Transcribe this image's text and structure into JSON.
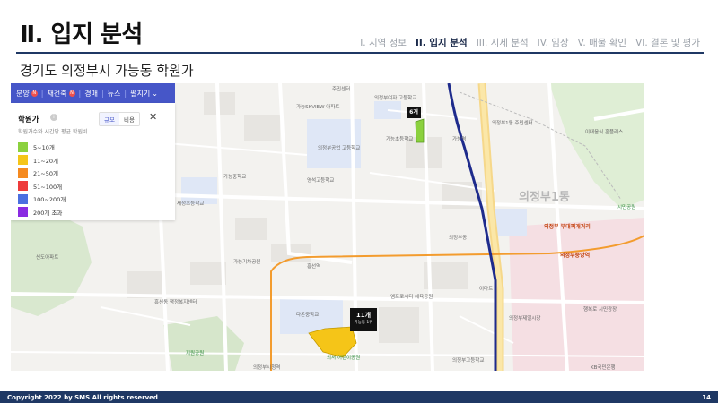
{
  "header": {
    "title": "Ⅱ. 입지 분석",
    "subtitle": "경기도 의정부시 가능동 학원가",
    "nav": [
      {
        "label": "I. 지역 정보",
        "active": false
      },
      {
        "label": "II. 입지 분석",
        "active": true
      },
      {
        "label": "III. 시세 분석",
        "active": false
      },
      {
        "label": "IV. 임장",
        "active": false
      },
      {
        "label": "V. 매물 확인",
        "active": false
      },
      {
        "label": "VI. 결론 및 평가",
        "active": false
      }
    ]
  },
  "map": {
    "toolbar": {
      "items": [
        {
          "label": "분양",
          "badge": "N"
        },
        {
          "label": "재건축",
          "badge": "N"
        },
        {
          "label": "경매",
          "badge": ""
        },
        {
          "label": "뉴스",
          "badge": ""
        },
        {
          "label": "펼치기",
          "badge": ""
        }
      ]
    },
    "legend": {
      "title": "학원가",
      "info_icon": "i",
      "description": "학원가수와 시간당 평균 학원비",
      "toggle": [
        "규모",
        "비용"
      ],
      "close": "✕",
      "items": [
        {
          "label": "5~10개",
          "color": "#8bd13e"
        },
        {
          "label": "11~20개",
          "color": "#f5c518"
        },
        {
          "label": "21~50개",
          "color": "#f58a1f"
        },
        {
          "label": "51~100개",
          "color": "#ee3b3b"
        },
        {
          "label": "100~200개",
          "color": "#4b6fe0"
        },
        {
          "label": "200개 초과",
          "color": "#8a2be2"
        }
      ]
    },
    "markers": [
      {
        "count": "6개",
        "sub": ""
      },
      {
        "count": "11개",
        "sub": "가능동 1위"
      }
    ],
    "labels": [
      {
        "text": "주민센터"
      },
      {
        "text": "가능SKVIEW 아파트"
      },
      {
        "text": "의정부여자 고등학교"
      },
      {
        "text": "가능초등학교"
      },
      {
        "text": "가능역"
      },
      {
        "text": "의정부공업 고등학교"
      },
      {
        "text": "영석고등학교"
      },
      {
        "text": "가능중학교"
      },
      {
        "text": "의정부동"
      },
      {
        "text": "의정부1동"
      },
      {
        "text": "의정부 부대찌개거리"
      },
      {
        "text": "의정부중앙역"
      },
      {
        "text": "흥선역"
      },
      {
        "text": "의정부시청역"
      },
      {
        "text": "엠프로시티 체육공원"
      },
      {
        "text": "의정부고등학교"
      },
      {
        "text": "흥선동 행정복지센터"
      },
      {
        "text": "신도아파트"
      },
      {
        "text": "재정초등학교"
      },
      {
        "text": "지원공원"
      },
      {
        "text": "가능기차공원"
      },
      {
        "text": "행복로 시민광장"
      },
      {
        "text": "의정부제일시장"
      },
      {
        "text": "다온중학교"
      },
      {
        "text": "외서 어린이공원"
      },
      {
        "text": "의정부1동 주민센터"
      },
      {
        "text": "KB국민은행"
      },
      {
        "text": "시민공원"
      },
      {
        "text": "이마트"
      },
      {
        "text": "이대음식 홈플러스"
      }
    ]
  },
  "footer": {
    "copyright": "Copyright 2022 by SMS All rights reserved",
    "page": "14"
  }
}
